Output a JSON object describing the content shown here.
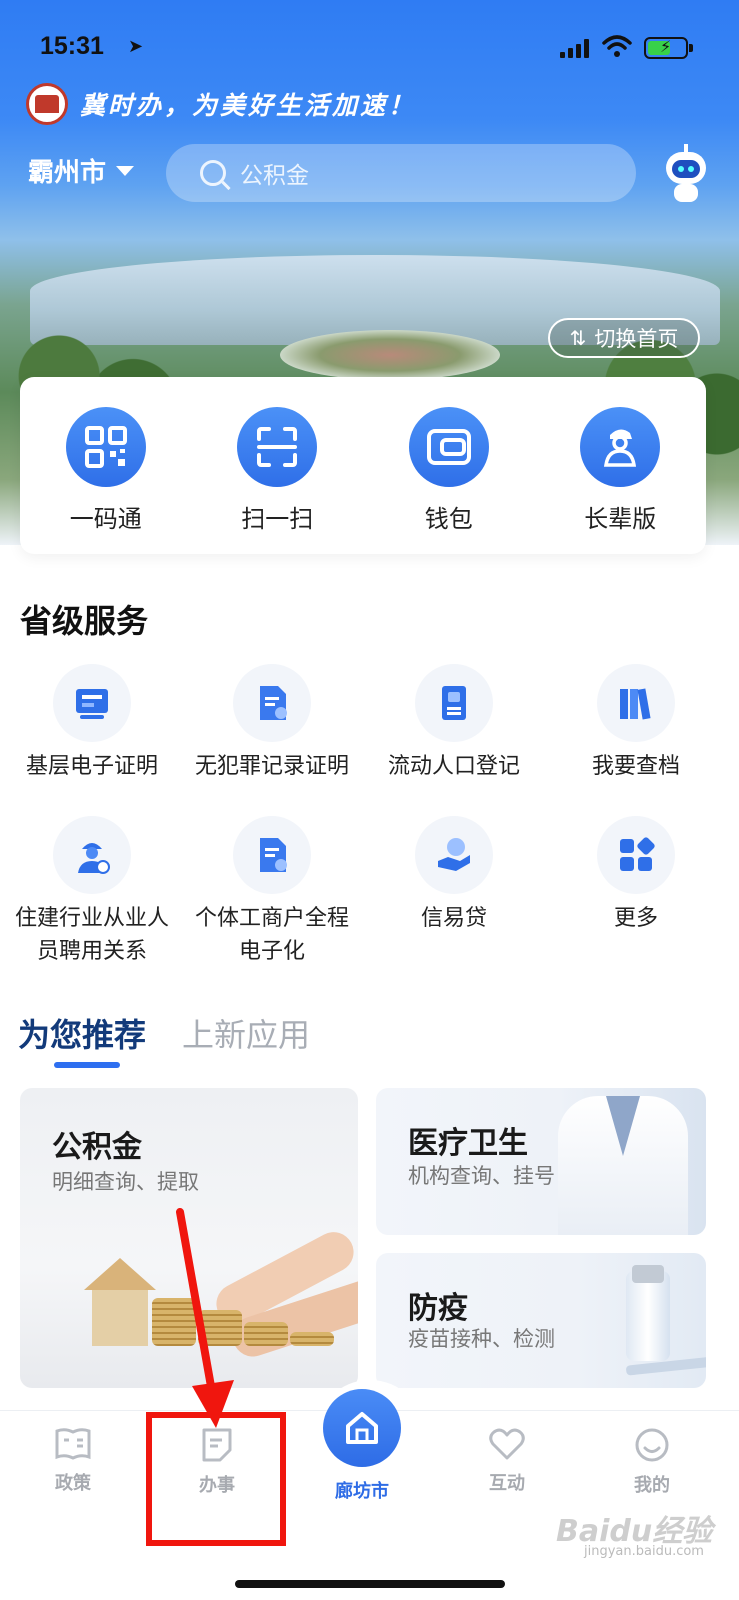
{
  "status_bar": {
    "time": "15:31",
    "location_glyph": "➤"
  },
  "header": {
    "slogan": "冀时办，为美好生活加速！",
    "city": "霸州市",
    "search_placeholder": "公积金",
    "switch_label": "切换首页",
    "switch_icon": "⇅"
  },
  "quick_actions": [
    {
      "label": "一码通",
      "icon": "qr-code-icon"
    },
    {
      "label": "扫一扫",
      "icon": "scan-icon"
    },
    {
      "label": "钱包",
      "icon": "wallet-icon"
    },
    {
      "label": "长辈版",
      "icon": "elder-icon"
    }
  ],
  "provincial": {
    "title": "省级服务",
    "items": [
      {
        "label": "基层电子证明",
        "icon": "certificate-icon"
      },
      {
        "label": "无犯罪记录证明",
        "icon": "record-doc-icon"
      },
      {
        "label": "流动人口登记",
        "icon": "register-icon"
      },
      {
        "label": "我要查档",
        "icon": "archive-icon"
      },
      {
        "label": "住建行业从业人员聘用关系",
        "icon": "worker-icon"
      },
      {
        "label": "个体工商户全程电子化",
        "icon": "business-doc-icon"
      },
      {
        "label": "信易贷",
        "icon": "loan-icon"
      },
      {
        "label": "更多",
        "icon": "more-apps-icon"
      }
    ]
  },
  "tabs": [
    {
      "label": "为您推荐",
      "active": true
    },
    {
      "label": "上新应用",
      "active": false
    }
  ],
  "recommend": {
    "housing_fund": {
      "title": "公积金",
      "subtitle": "明细查询、提取"
    },
    "medical": {
      "title": "医疗卫生",
      "subtitle": "机构查询、挂号"
    },
    "epidemic": {
      "title": "防疫",
      "subtitle": "疫苗接种、检测"
    }
  },
  "bottom_nav": [
    {
      "label": "政策",
      "icon": "policy-book-icon"
    },
    {
      "label": "办事",
      "icon": "affairs-doc-icon"
    },
    {
      "label": "廊坊市",
      "icon": "home-icon",
      "active": true
    },
    {
      "label": "互动",
      "icon": "heart-icon"
    },
    {
      "label": "我的",
      "icon": "smile-icon"
    }
  ],
  "watermark": {
    "main": "Baidu经验",
    "sub": "jingyan.baidu.com"
  },
  "colors": {
    "primary": "#2e6ff0",
    "annotation": "#f0160e",
    "active_tab": "#123a7a"
  }
}
